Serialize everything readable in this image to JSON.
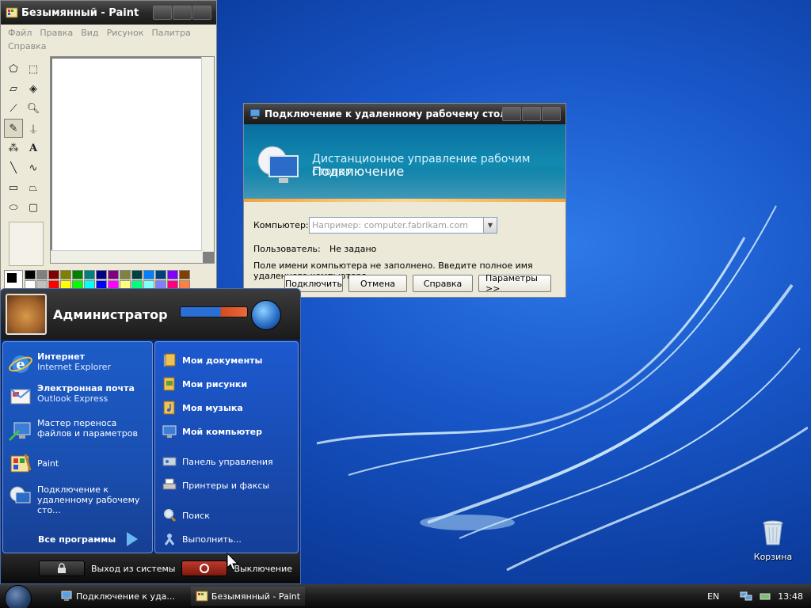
{
  "paint": {
    "title": "Безымянный - Paint",
    "menu": [
      "Файл",
      "Правка",
      "Вид",
      "Рисунок",
      "Палитра",
      "Справка"
    ],
    "palette_colors": [
      "#000000",
      "#808080",
      "#800000",
      "#808000",
      "#008000",
      "#008080",
      "#000080",
      "#800080",
      "#808040",
      "#004040",
      "#0080ff",
      "#004080",
      "#8000ff",
      "#804000",
      "#ffffff",
      "#c0c0c0",
      "#ff0000",
      "#ffff00",
      "#00ff00",
      "#00ffff",
      "#0000ff",
      "#ff00ff",
      "#ffff80",
      "#00ff80",
      "#80ffff",
      "#8080ff",
      "#ff0080",
      "#ff8040"
    ]
  },
  "rdp": {
    "title": "Подключение к удаленному рабочему столу",
    "banner_line1": "Дистанционное управление рабочим столом",
    "banner_line2": "Подключение",
    "computer_label": "Компьютер:",
    "computer_placeholder": "Например: computer.fabrikam.com",
    "user_label": "Пользователь:",
    "user_value": "Не задано",
    "note": "Поле имени компьютера не заполнено. Введите полное имя удаленного компьютера.",
    "buttons": {
      "connect": "Подключить",
      "cancel": "Отмена",
      "help": "Справка",
      "options": "Параметры >>"
    }
  },
  "start_menu": {
    "username": "Администратор",
    "left_items": [
      {
        "title": "Интернет",
        "subtitle": "Internet Explorer"
      },
      {
        "title": "Электронная почта",
        "subtitle": "Outlook Express"
      },
      {
        "title": "Мастер переноса файлов и параметров"
      },
      {
        "title": "Paint"
      },
      {
        "title": "Подключение к удаленному рабочему сто..."
      }
    ],
    "all_programs": "Все программы",
    "right_items": [
      {
        "label": "Мои документы",
        "bold": true
      },
      {
        "label": "Мои рисунки",
        "bold": true
      },
      {
        "label": "Моя музыка",
        "bold": true
      },
      {
        "label": "Мой компьютер",
        "bold": true
      },
      {
        "label": "Панель управления",
        "bold": false
      },
      {
        "label": "Принтеры и факсы",
        "bold": false
      },
      {
        "label": "Поиск",
        "bold": false
      },
      {
        "label": "Выполнить...",
        "bold": false
      }
    ],
    "logoff": "Выход из системы",
    "shutdown": "Выключение"
  },
  "desktop": {
    "recycle_bin": "Корзина"
  },
  "taskbar": {
    "tasks": [
      "Подключение к уда...",
      "Безымянный - Paint"
    ],
    "lang": "EN",
    "clock": "13:48"
  }
}
